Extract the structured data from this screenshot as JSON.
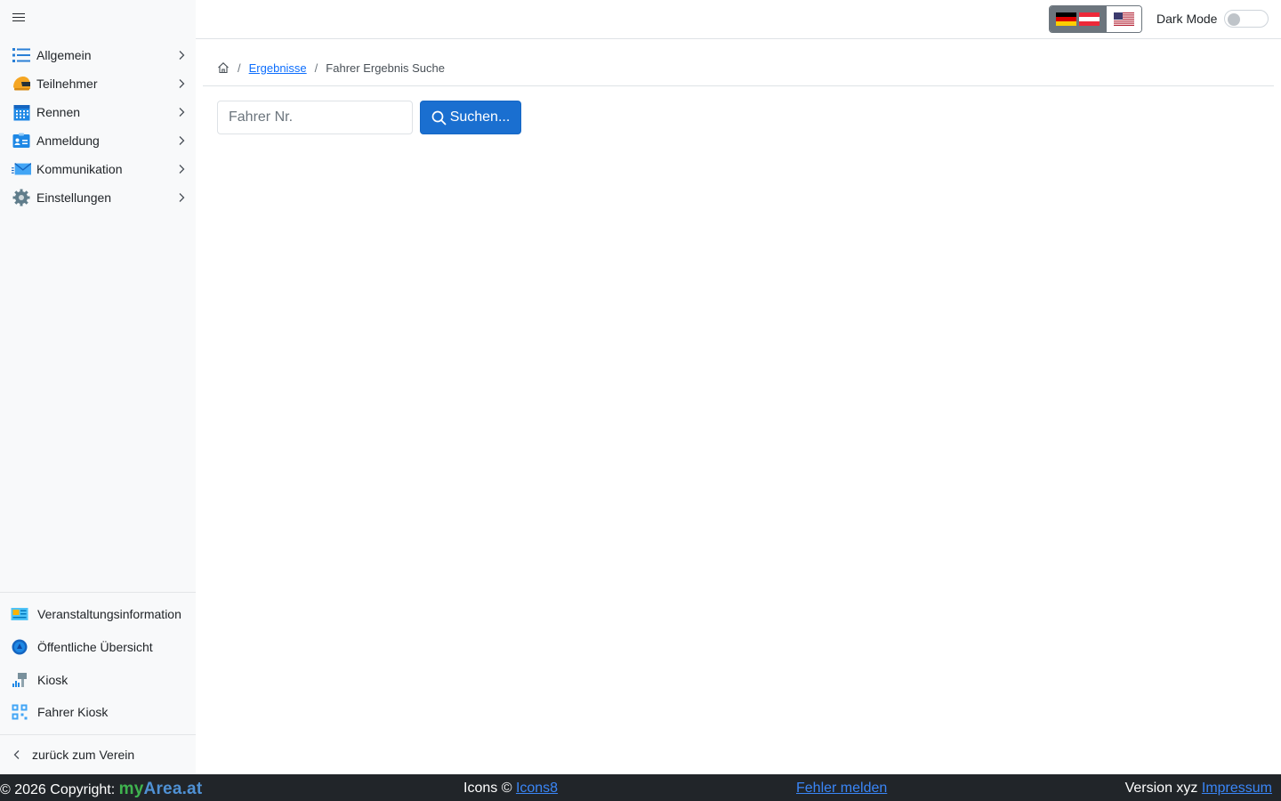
{
  "sidebar": {
    "nav": [
      {
        "label": "Allgemein",
        "icon": "list-icon"
      },
      {
        "label": "Teilnehmer",
        "icon": "helmet-icon"
      },
      {
        "label": "Rennen",
        "icon": "calendar-icon"
      },
      {
        "label": "Anmeldung",
        "icon": "id-card-icon"
      },
      {
        "label": "Kommunikation",
        "icon": "mail-icon"
      },
      {
        "label": "Einstellungen",
        "icon": "gear-icon"
      }
    ],
    "bottom": [
      {
        "label": "Veranstaltungsinformation",
        "icon": "info-board-icon"
      },
      {
        "label": "Öffentliche Übersicht",
        "icon": "globe-icon"
      },
      {
        "label": "Kiosk",
        "icon": "kiosk-icon"
      },
      {
        "label": "Fahrer Kiosk",
        "icon": "qr-code-icon"
      }
    ],
    "back_label": "zurück zum Verein"
  },
  "topbar": {
    "dark_mode_label": "Dark Mode",
    "dark_mode_on": false
  },
  "breadcrumb": {
    "link": "Ergebnisse",
    "current": "Fahrer Ergebnis Suche"
  },
  "search": {
    "placeholder": "Fahrer Nr.",
    "value": "",
    "button_label": "Suchen..."
  },
  "footer": {
    "copyright": "© 2026 Copyright:",
    "brand_my": "my",
    "brand_area": "Area.at",
    "icons_text": "Icons ©",
    "icons_link": "Icons8",
    "report_link": "Fehler melden",
    "version_text": "Version xyz",
    "impressum_link": "Impressum"
  },
  "colors": {
    "primary": "#1a6fd0",
    "footer_bg": "#212529",
    "link": "#0d6efd"
  }
}
